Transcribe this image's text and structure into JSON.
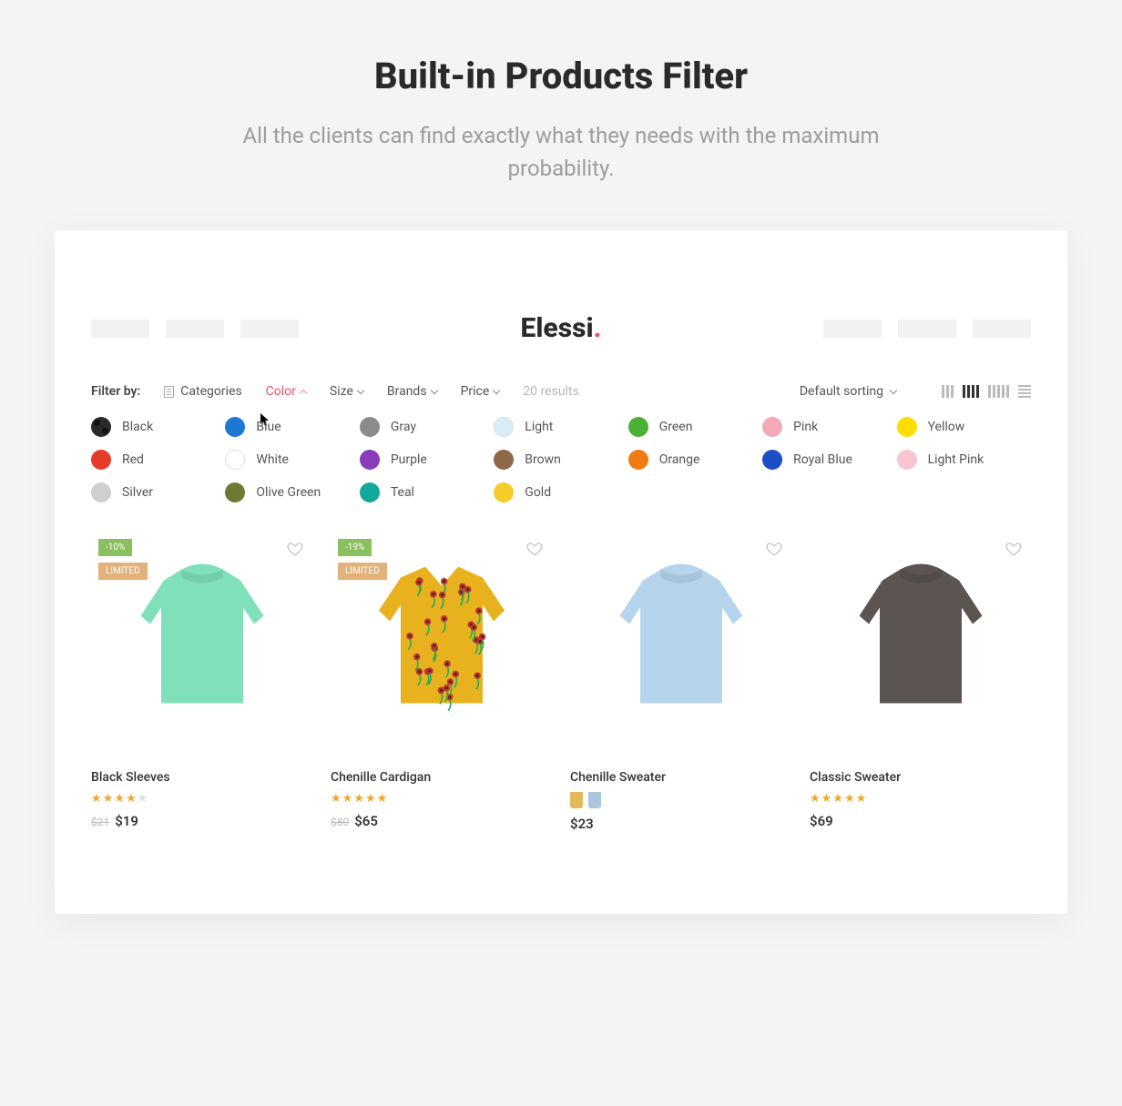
{
  "hero": {
    "title": "Built-in Products Filter",
    "subtitle": "All the clients can find exactly what they needs with the maximum probability."
  },
  "logo": {
    "text": "Elessi",
    "dot": "."
  },
  "filter": {
    "label": "Filter by:",
    "categories": "Categories",
    "color": "Color",
    "size": "Size",
    "brands": "Brands",
    "price": "Price",
    "results": "20 results",
    "sort": "Default sorting"
  },
  "colors": [
    {
      "name": "Black",
      "hex": "#2a2a2a",
      "pattern": true
    },
    {
      "name": "Blue",
      "hex": "#1e77d3"
    },
    {
      "name": "Gray",
      "hex": "#8b8b8b"
    },
    {
      "name": "Light",
      "hex": "#d9ecf7",
      "border": true
    },
    {
      "name": "Green",
      "hex": "#4caf36"
    },
    {
      "name": "Pink",
      "hex": "#f3a9b7"
    },
    {
      "name": "Yellow",
      "hex": "#ffdd00"
    },
    {
      "name": "Red",
      "hex": "#e43b2a"
    },
    {
      "name": "White",
      "hex": "#ffffff",
      "border": true
    },
    {
      "name": "Purple",
      "hex": "#8a3dbb"
    },
    {
      "name": "Brown",
      "hex": "#8d6948"
    },
    {
      "name": "Orange",
      "hex": "#f07b15"
    },
    {
      "name": "Royal Blue",
      "hex": "#1b4ec7"
    },
    {
      "name": "Light Pink",
      "hex": "#f7c6d1"
    },
    {
      "name": "Silver",
      "hex": "#cfcfcf"
    },
    {
      "name": "Olive Green",
      "hex": "#6d7a33"
    },
    {
      "name": "Teal",
      "hex": "#12a89b"
    },
    {
      "name": "Gold",
      "hex": "#f5cc29"
    }
  ],
  "products": [
    {
      "name": "Black Sleeves",
      "rating": 4,
      "old_price": "$21",
      "price": "$19",
      "badges": [
        "-10%",
        "LIMITED"
      ],
      "img_color": "#7fe0b9",
      "type": "crew"
    },
    {
      "name": "Chenille Cardigan",
      "rating": 4.5,
      "old_price": "$80",
      "price": "$65",
      "badges": [
        "-19%",
        "LIMITED"
      ],
      "img_color": "#e8b21f",
      "type": "floral"
    },
    {
      "name": "Chenille Sweater",
      "rating": 0,
      "price": "$23",
      "badges": [],
      "variants": [
        "#e6b85c",
        "#a8c6dd"
      ],
      "img_color": "#b6d5ec",
      "type": "crew"
    },
    {
      "name": "Classic Sweater",
      "rating": 5,
      "price": "$69",
      "badges": [],
      "img_color": "#5b5451",
      "type": "crew"
    }
  ]
}
